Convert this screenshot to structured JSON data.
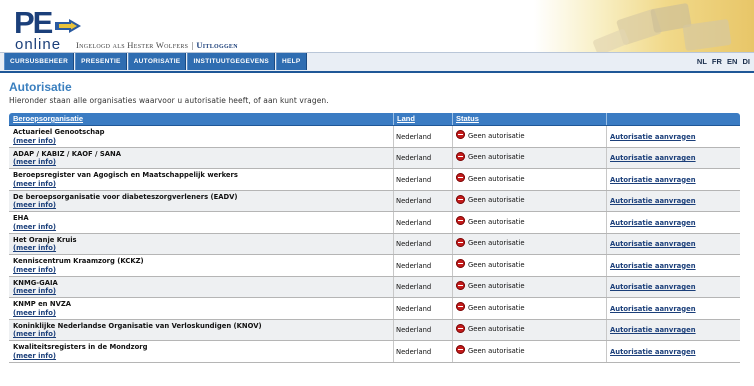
{
  "logo": {
    "pe": "PE",
    "online": "online"
  },
  "login": {
    "text": "Ingelogd als Hester Wolfers",
    "separator": "|",
    "logout": "Uitloggen"
  },
  "nav": {
    "tabs": [
      "Cursusbeheer",
      "Presentie",
      "Autorisatie",
      "Instituutgegevens",
      "Help"
    ],
    "languages": [
      "NL",
      "FR",
      "EN",
      "DI"
    ]
  },
  "page": {
    "title": "Autorisatie",
    "intro": "Hieronder staan alle organisaties waarvoor u autorisatie heeft, of aan kunt vragen."
  },
  "table": {
    "headers": {
      "org": "Beroepsorganisatie",
      "land": "Land",
      "status": "Status"
    },
    "rows": [
      {
        "name": "Actuarieel Genootschap",
        "more": "(meer info)",
        "land": "Nederland",
        "status": "Geen autorisatie",
        "action": "Autorisatie aanvragen"
      },
      {
        "name": "ADAP / KABIZ / KAOF / SANA",
        "more": "(meer info)",
        "land": "Nederland",
        "status": "Geen autorisatie",
        "action": "Autorisatie aanvragen"
      },
      {
        "name": "Beroepsregister van Agogisch en Maatschappelijk werkers",
        "more": "(meer info)",
        "land": "Nederland",
        "status": "Geen autorisatie",
        "action": "Autorisatie aanvragen"
      },
      {
        "name": "De beroepsorganisatie voor diabeteszorgverleners (EADV)",
        "more": "(meer info)",
        "land": "Nederland",
        "status": "Geen autorisatie",
        "action": "Autorisatie aanvragen"
      },
      {
        "name": "EHA",
        "more": "(meer info)",
        "land": "Nederland",
        "status": "Geen autorisatie",
        "action": "Autorisatie aanvragen"
      },
      {
        "name": "Het Oranje Kruis",
        "more": "(meer info)",
        "land": "Nederland",
        "status": "Geen autorisatie",
        "action": "Autorisatie aanvragen"
      },
      {
        "name": "Kenniscentrum Kraamzorg (KCKZ)",
        "more": "(meer info)",
        "land": "Nederland",
        "status": "Geen autorisatie",
        "action": "Autorisatie aanvragen"
      },
      {
        "name": "KNMG-GAIA",
        "more": "(meer info)",
        "land": "Nederland",
        "status": "Geen autorisatie",
        "action": "Autorisatie aanvragen"
      },
      {
        "name": "KNMP en NVZA",
        "more": "(meer info)",
        "land": "Nederland",
        "status": "Geen autorisatie",
        "action": "Autorisatie aanvragen"
      },
      {
        "name": "Koninklijke Nederlandse Organisatie van Verloskundigen (KNOV)",
        "more": "(meer info)",
        "land": "Nederland",
        "status": "Geen autorisatie",
        "action": "Autorisatie aanvragen"
      },
      {
        "name": "Kwaliteitsregisters in de Mondzorg",
        "more": "(meer info)",
        "land": "Nederland",
        "status": "Geen autorisatie",
        "action": "Autorisatie aanvragen"
      }
    ]
  },
  "colors": {
    "brand": "#1b3f7a",
    "nav_tab": "#2f6db1",
    "title": "#3a7fbf",
    "status_icon": "#c41a1a"
  },
  "icons": {
    "status": "no-entry-icon",
    "logo_arrow": "arrow-right-icon"
  }
}
